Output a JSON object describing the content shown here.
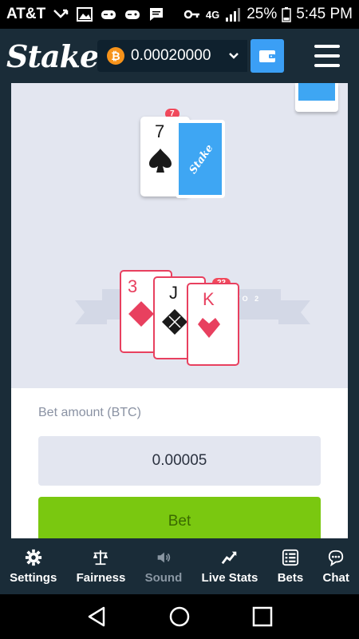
{
  "status_bar": {
    "carrier": "AT&T",
    "network": "4G",
    "network_sub": "LTE",
    "battery": "25%",
    "time": "5:45 PM"
  },
  "header": {
    "logo_text": "Stake",
    "currency_symbol": "₿",
    "balance": "0.00020000",
    "icons": [
      "bitcoin-icon",
      "chevron-down-icon",
      "wallet-icon",
      "hamburger-menu-icon"
    ]
  },
  "table": {
    "dealer": {
      "total": "7",
      "cards": [
        {
          "rank": "7",
          "suit": "spade"
        }
      ],
      "hidden_card_text": "Stake"
    },
    "ribbon_text": "BLACKJACK PAYS 3 TO 2",
    "insurance_text": "INSURANCE PAYS 2 TO 1",
    "player": {
      "total": "23",
      "cards": [
        {
          "rank": "3",
          "suit": "diamond"
        },
        {
          "rank": "J",
          "suit": "club"
        },
        {
          "rank": "K",
          "suit": "heart"
        }
      ]
    }
  },
  "bet": {
    "label": "Bet amount (BTC)",
    "value": "0.00005",
    "button_label": "Bet"
  },
  "tabs": [
    {
      "label": "Settings",
      "icon": "gear-icon"
    },
    {
      "label": "Fairness",
      "icon": "scales-icon"
    },
    {
      "label": "Sound",
      "icon": "speaker-icon"
    },
    {
      "label": "Live Stats",
      "icon": "chart-line-icon"
    },
    {
      "label": "Bets",
      "icon": "list-icon"
    },
    {
      "label": "Chat",
      "icon": "chat-bubble-icon"
    }
  ],
  "colors": {
    "accent_green": "#7ac810",
    "accent_blue": "#3b9ff5",
    "card_red": "#e8405f",
    "header_bg": "#1a2c38"
  }
}
